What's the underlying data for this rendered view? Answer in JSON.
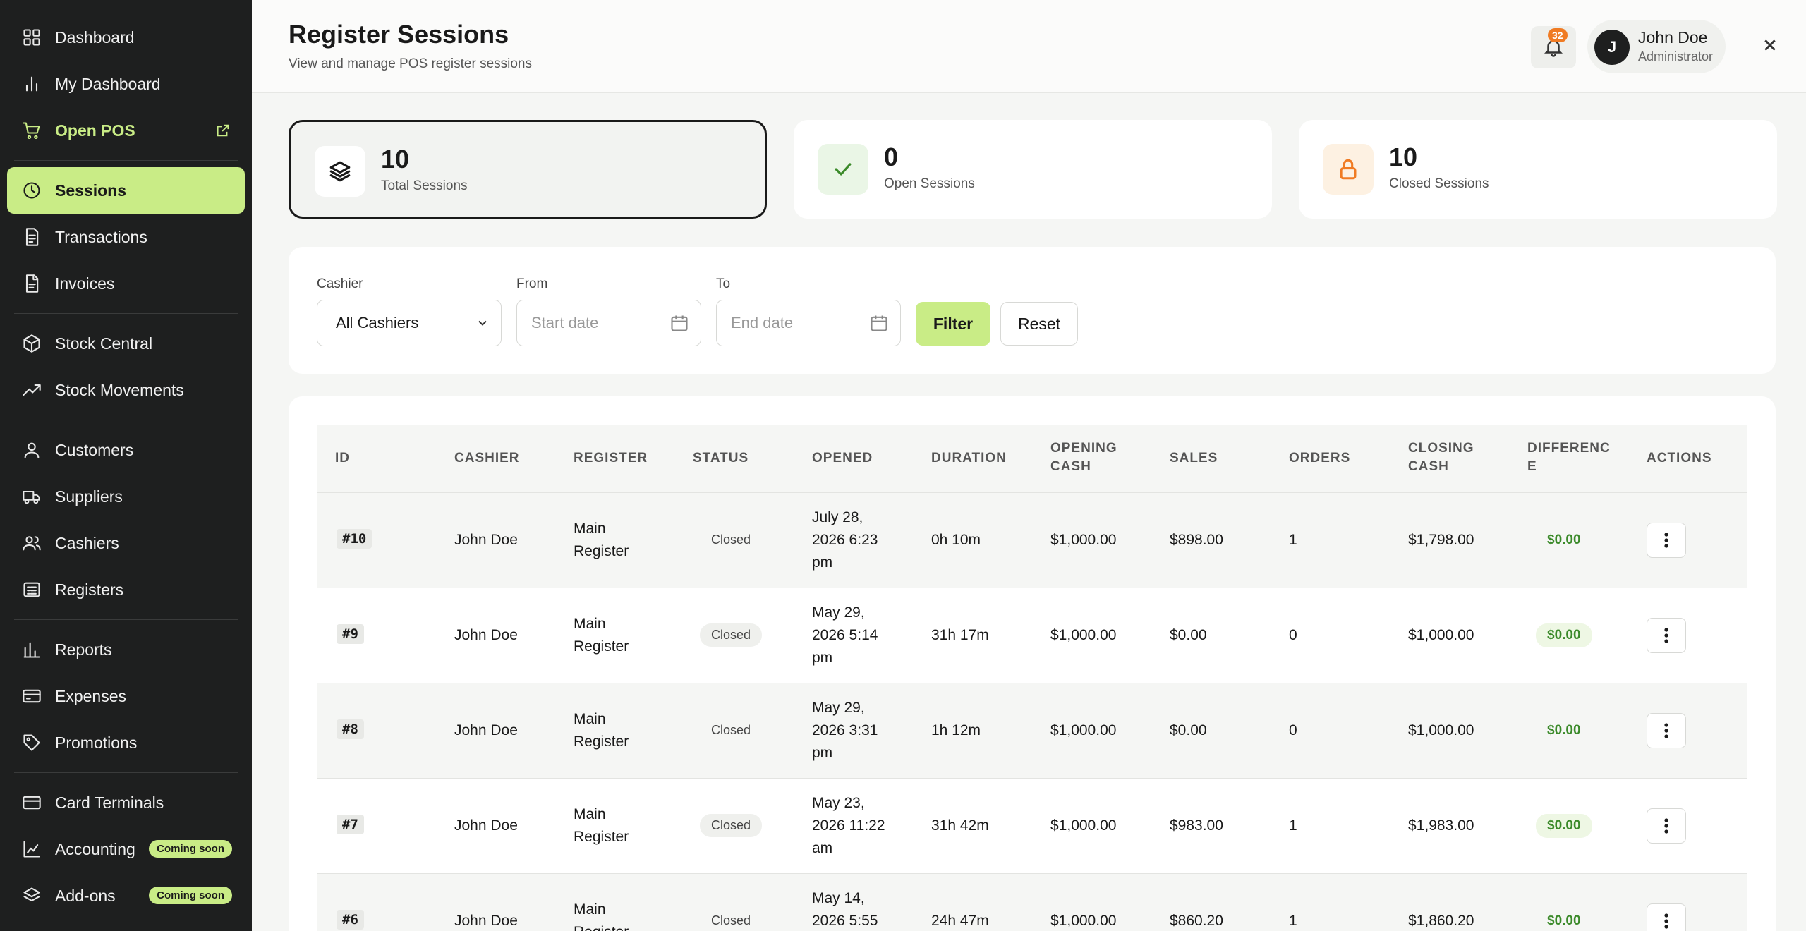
{
  "sidebar": {
    "items": [
      {
        "label": "Dashboard",
        "icon": "grid-icon"
      },
      {
        "label": "My Dashboard",
        "icon": "bar-chart-icon"
      },
      {
        "label": "Open POS",
        "icon": "cart-icon"
      },
      {
        "label": "Sessions",
        "icon": "clock-icon"
      },
      {
        "label": "Transactions",
        "icon": "document-icon"
      },
      {
        "label": "Invoices",
        "icon": "invoice-icon"
      },
      {
        "label": "Stock Central",
        "icon": "box-icon"
      },
      {
        "label": "Stock Movements",
        "icon": "trending-icon"
      },
      {
        "label": "Customers",
        "icon": "user-icon"
      },
      {
        "label": "Suppliers",
        "icon": "truck-icon"
      },
      {
        "label": "Cashiers",
        "icon": "users-icon"
      },
      {
        "label": "Registers",
        "icon": "register-icon"
      },
      {
        "label": "Reports",
        "icon": "reports-icon"
      },
      {
        "label": "Expenses",
        "icon": "wallet-icon"
      },
      {
        "label": "Promotions",
        "icon": "tag-icon"
      },
      {
        "label": "Card Terminals",
        "icon": "card-icon"
      },
      {
        "label": "Accounting",
        "icon": "chart-icon",
        "badge": "Coming soon"
      },
      {
        "label": "Add-ons",
        "icon": "layers-icon",
        "badge": "Coming soon"
      }
    ],
    "active": "Sessions"
  },
  "header": {
    "title": "Register Sessions",
    "subtitle": "View and manage POS register sessions",
    "notification_count": "32",
    "user_initial": "J",
    "user_name": "John Doe",
    "user_role": "Administrator"
  },
  "stats": [
    {
      "value": "10",
      "label": "Total Sessions"
    },
    {
      "value": "0",
      "label": "Open Sessions"
    },
    {
      "value": "10",
      "label": "Closed Sessions"
    }
  ],
  "filters": {
    "cashier_label": "Cashier",
    "cashier_value": "All Cashiers",
    "from_label": "From",
    "from_placeholder": "Start date",
    "to_label": "To",
    "to_placeholder": "End date",
    "filter_button": "Filter",
    "reset_button": "Reset"
  },
  "table": {
    "headers": [
      "ID",
      "CASHIER",
      "REGISTER",
      "STATUS",
      "OPENED",
      "DURATION",
      "OPENING CASH",
      "SALES",
      "ORDERS",
      "CLOSING CASH",
      "DIFFERENCE",
      "ACTIONS"
    ],
    "rows": [
      {
        "id": "#10",
        "cashier": "John Doe",
        "register": "Main Register",
        "status": "Closed",
        "opened": "July 28, 2026 6:23 pm",
        "duration": "0h 10m",
        "opening_cash": "$1,000.00",
        "sales": "$898.00",
        "orders": "1",
        "closing_cash": "$1,798.00",
        "difference": "$0.00"
      },
      {
        "id": "#9",
        "cashier": "John Doe",
        "register": "Main Register",
        "status": "Closed",
        "opened": "May 29, 2026 5:14 pm",
        "duration": "31h 17m",
        "opening_cash": "$1,000.00",
        "sales": "$0.00",
        "orders": "0",
        "closing_cash": "$1,000.00",
        "difference": "$0.00"
      },
      {
        "id": "#8",
        "cashier": "John Doe",
        "register": "Main Register",
        "status": "Closed",
        "opened": "May 29, 2026 3:31 pm",
        "duration": "1h 12m",
        "opening_cash": "$1,000.00",
        "sales": "$0.00",
        "orders": "0",
        "closing_cash": "$1,000.00",
        "difference": "$0.00"
      },
      {
        "id": "#7",
        "cashier": "John Doe",
        "register": "Main Register",
        "status": "Closed",
        "opened": "May 23, 2026 11:22 am",
        "duration": "31h 42m",
        "opening_cash": "$1,000.00",
        "sales": "$983.00",
        "orders": "1",
        "closing_cash": "$1,983.00",
        "difference": "$0.00"
      },
      {
        "id": "#6",
        "cashier": "John Doe",
        "register": "Main Register",
        "status": "Closed",
        "opened": "May 14, 2026 5:55",
        "duration": "24h 47m",
        "opening_cash": "$1,000.00",
        "sales": "$860.20",
        "orders": "1",
        "closing_cash": "$1,860.20",
        "difference": "$0.00"
      }
    ]
  },
  "colors": {
    "accent": "#c9ec86",
    "sidebar_bg": "#1e1f1f",
    "badge_orange": "#f07b23",
    "success_green": "#3b8a2a"
  }
}
